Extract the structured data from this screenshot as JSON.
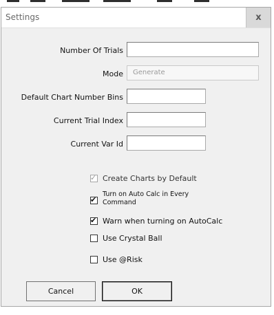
{
  "window": {
    "title": "Settings",
    "close_label": "x"
  },
  "fields": [
    {
      "label": "Number Of Trials",
      "value": "",
      "placeholder": "",
      "disabled": false
    },
    {
      "label": "Mode",
      "value": "Generate",
      "placeholder": "",
      "disabled": true
    },
    {
      "label": "Default Chart Number Bins",
      "value": "",
      "placeholder": "",
      "disabled": false
    },
    {
      "label": "Current Trial Index",
      "value": "",
      "placeholder": "",
      "disabled": false
    },
    {
      "label": "Current Var Id",
      "value": "",
      "placeholder": "",
      "disabled": false
    }
  ],
  "checkboxes": [
    {
      "label": "Create Charts by Default",
      "checked": true,
      "disabled": true
    },
    {
      "label": "Turn on Auto Calc in Every Command",
      "checked": true,
      "disabled": false
    },
    {
      "label": "Warn when turning on AutoCalc",
      "checked": true,
      "disabled": false
    },
    {
      "label": "Use Crystal Ball",
      "checked": false,
      "disabled": false
    },
    {
      "label": "Use @Risk",
      "checked": false,
      "disabled": false
    }
  ],
  "buttons": {
    "cancel": "Cancel",
    "ok": "OK"
  },
  "icons": {
    "close": "close-icon",
    "check": "checkmark-icon"
  }
}
